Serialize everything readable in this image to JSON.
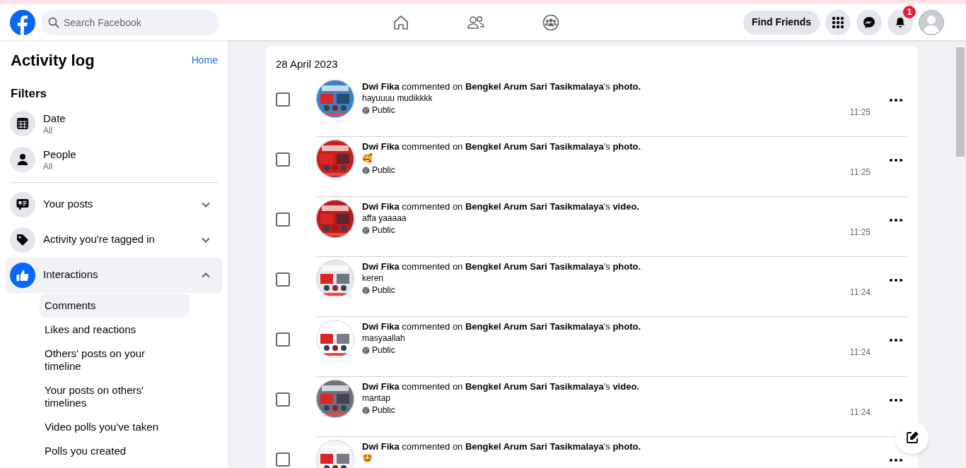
{
  "header": {
    "search": {
      "placeholder": "Search Facebook"
    },
    "find_friends": "Find Friends",
    "notifications_badge": "1"
  },
  "sidebar": {
    "title": "Activity log",
    "home_link": "Home",
    "filters_title": "Filters",
    "filters": [
      {
        "kind": "date",
        "label": "Date",
        "value": "All"
      },
      {
        "kind": "people",
        "label": "People",
        "value": "All"
      }
    ],
    "categories": [
      {
        "kind": "posts",
        "label": "Your posts",
        "expanded": false
      },
      {
        "kind": "tag",
        "label": "Activity you're tagged in",
        "expanded": false
      },
      {
        "kind": "like",
        "label": "Interactions",
        "expanded": true,
        "children": [
          {
            "label": "Comments",
            "selected": true
          },
          {
            "label": "Likes and reactions",
            "selected": false
          },
          {
            "label": "Others' posts on your timeline",
            "selected": false
          },
          {
            "label": "Your posts on others' timelines",
            "selected": false
          },
          {
            "label": "Video polls you've taken",
            "selected": false
          },
          {
            "label": "Polls you created",
            "selected": false
          }
        ]
      }
    ]
  },
  "log": {
    "date": "28 April 2023",
    "entries": [
      {
        "text": "**Dwi Fika** commented on **Bengkel Arum Sari Tasikmalaya**'s **photo.**",
        "comment": "hayuuuu mudikkkk",
        "audience": "Public",
        "time": "11:25",
        "checked": false
      },
      {
        "text": "**Dwi Fika** commented on **Bengkel Arum Sari Tasikmalaya**'s **photo.**",
        "comment": "🥰",
        "audience": "Public",
        "time": "11:25",
        "checked": false
      },
      {
        "text": "**Dwi Fika** commented on **Bengkel Arum Sari Tasikmalaya**'s **video.**",
        "comment": "affa yaaaaa",
        "audience": "Public",
        "time": "11:25",
        "checked": false
      },
      {
        "text": "**Dwi Fika** commented on **Bengkel Arum Sari Tasikmalaya**'s **photo.**",
        "comment": "keren",
        "audience": "Public",
        "time": "11:24",
        "checked": false
      },
      {
        "text": "**Dwi Fika** commented on **Bengkel Arum Sari Tasikmalaya**'s **photo.**",
        "comment": "masyaallah",
        "audience": "Public",
        "time": "11:24",
        "checked": false
      },
      {
        "text": "**Dwi Fika** commented on **Bengkel Arum Sari Tasikmalaya**'s **video.**",
        "comment": "mantap",
        "audience": "Public",
        "time": "11:24",
        "checked": false
      },
      {
        "text": "**Dwi Fika** commented on **Bengkel Arum Sari Tasikmalaya**'s **photo.**",
        "comment": "🤩",
        "checked": false
      }
    ]
  }
}
